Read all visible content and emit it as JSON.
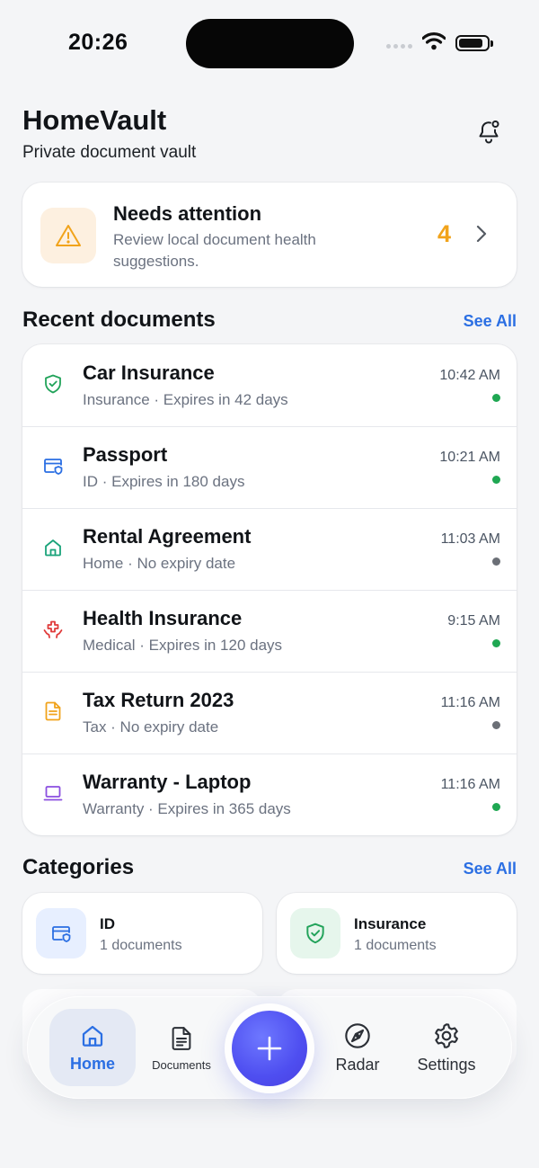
{
  "status_bar": {
    "time": "20:26",
    "battery_level": 0.85
  },
  "header": {
    "title": "HomeVault",
    "subtitle": "Private document vault"
  },
  "attention": {
    "title": "Needs attention",
    "description": "Review local document health suggestions.",
    "count": "4"
  },
  "recent": {
    "title": "Recent documents",
    "see_all": "See All",
    "items": [
      {
        "name": "Car Insurance",
        "meta": "Insurance · Expires in 42 days",
        "time": "10:42 AM",
        "status": "active",
        "icon": "shield-check-icon",
        "color": "#22a35a"
      },
      {
        "name": "Passport",
        "meta": "ID · Expires in 180 days",
        "time": "10:21 AM",
        "status": "active",
        "icon": "id-card-icon",
        "color": "#2b6fe3"
      },
      {
        "name": "Rental Agreement",
        "meta": "Home · No expiry date",
        "time": "11:03 AM",
        "status": "inactive",
        "icon": "home-icon",
        "color": "#1aa37a"
      },
      {
        "name": "Health Insurance",
        "meta": "Medical · Expires in 120 days",
        "time": "9:15 AM",
        "status": "active",
        "icon": "medical-hands-icon",
        "color": "#e03a3a"
      },
      {
        "name": "Tax Return 2023",
        "meta": "Tax · No expiry date",
        "time": "11:16 AM",
        "status": "inactive",
        "icon": "document-icon",
        "color": "#f1a31b"
      },
      {
        "name": "Warranty - Laptop",
        "meta": "Warranty · Expires in 365 days",
        "time": "11:16 AM",
        "status": "active",
        "icon": "laptop-icon",
        "color": "#8b4fe0"
      }
    ]
  },
  "status_colors": {
    "active": "#1fa752",
    "inactive": "#6b6f76"
  },
  "categories": {
    "title": "Categories",
    "see_all": "See All",
    "items": [
      {
        "name": "ID",
        "count": "1 documents",
        "icon": "id-card-icon",
        "color": "#2b6fe3",
        "bg": "#e7efff"
      },
      {
        "name": "Insurance",
        "count": "1 documents",
        "icon": "shield-check-icon",
        "color": "#22a35a",
        "bg": "#e6f6ec"
      }
    ]
  },
  "tabs": {
    "home": "Home",
    "documents": "Documents",
    "radar": "Radar",
    "settings": "Settings"
  },
  "accent": "#2b6fe3"
}
